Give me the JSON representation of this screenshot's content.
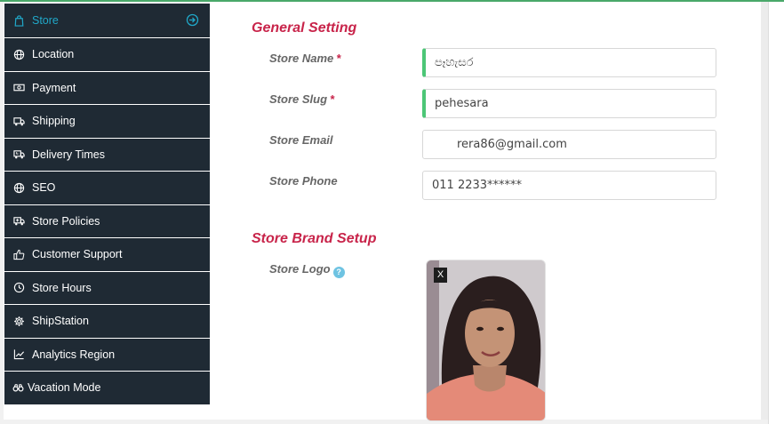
{
  "sidebar": {
    "items": [
      {
        "label": "Store",
        "icon": "shopping-bag-icon",
        "active": true
      },
      {
        "label": "Location",
        "icon": "globe-icon"
      },
      {
        "label": "Payment",
        "icon": "money-bill-icon"
      },
      {
        "label": "Shipping",
        "icon": "truck-icon"
      },
      {
        "label": "Delivery Times",
        "icon": "truck-clock-icon"
      },
      {
        "label": "SEO",
        "icon": "globe-icon"
      },
      {
        "label": "Store Policies",
        "icon": "ambulance-icon"
      },
      {
        "label": "Customer Support",
        "icon": "thumbs-up-icon"
      },
      {
        "label": "Store Hours",
        "icon": "clock-icon"
      },
      {
        "label": "ShipStation",
        "icon": "gear-icon"
      },
      {
        "label": "Analytics Region",
        "icon": "line-chart-icon"
      },
      {
        "label": "Vacation Mode",
        "icon": "binoculars-icon"
      }
    ]
  },
  "general": {
    "title": "General Setting",
    "store_name": {
      "label": "Store Name",
      "required": "*",
      "value": "පෑහැසර"
    },
    "store_slug": {
      "label": "Store Slug",
      "required": "*",
      "value": "pehesara"
    },
    "store_email": {
      "label": "Store Email",
      "value": "rera86@gmail.com"
    },
    "store_phone": {
      "label": "Store Phone",
      "value": "011 2233******"
    }
  },
  "brand": {
    "title": "Store Brand Setup",
    "logo_label": "Store Logo",
    "help_glyph": "?",
    "remove_label": "X"
  },
  "colors": {
    "sidebar_bg": "#1f2a34",
    "active": "#20a8c9",
    "section_title": "#c8244a",
    "field_marker": "#4cc676"
  }
}
